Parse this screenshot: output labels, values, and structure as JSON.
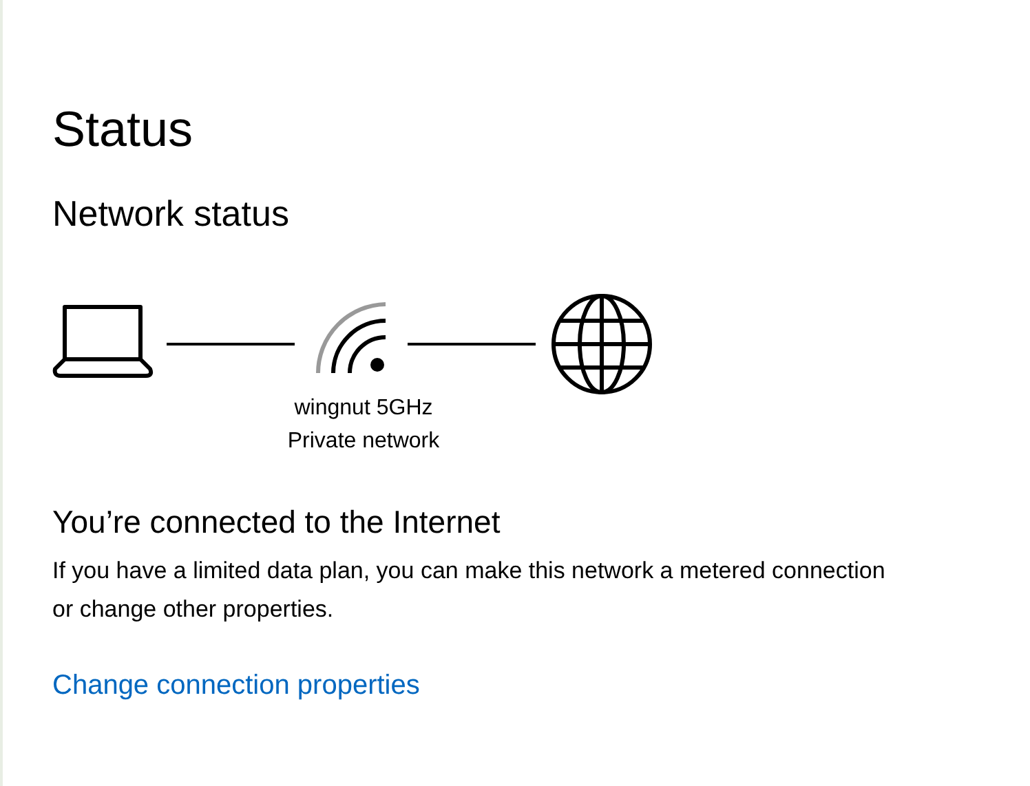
{
  "page": {
    "title": "Status"
  },
  "network_status": {
    "heading": "Network status",
    "network_name": "wingnut 5GHz",
    "network_type": "Private network"
  },
  "connection": {
    "heading": "You’re connected to the Internet",
    "description": "If you have a limited data plan, you can make this network a metered connection or change other properties.",
    "link": "Change connection properties"
  }
}
